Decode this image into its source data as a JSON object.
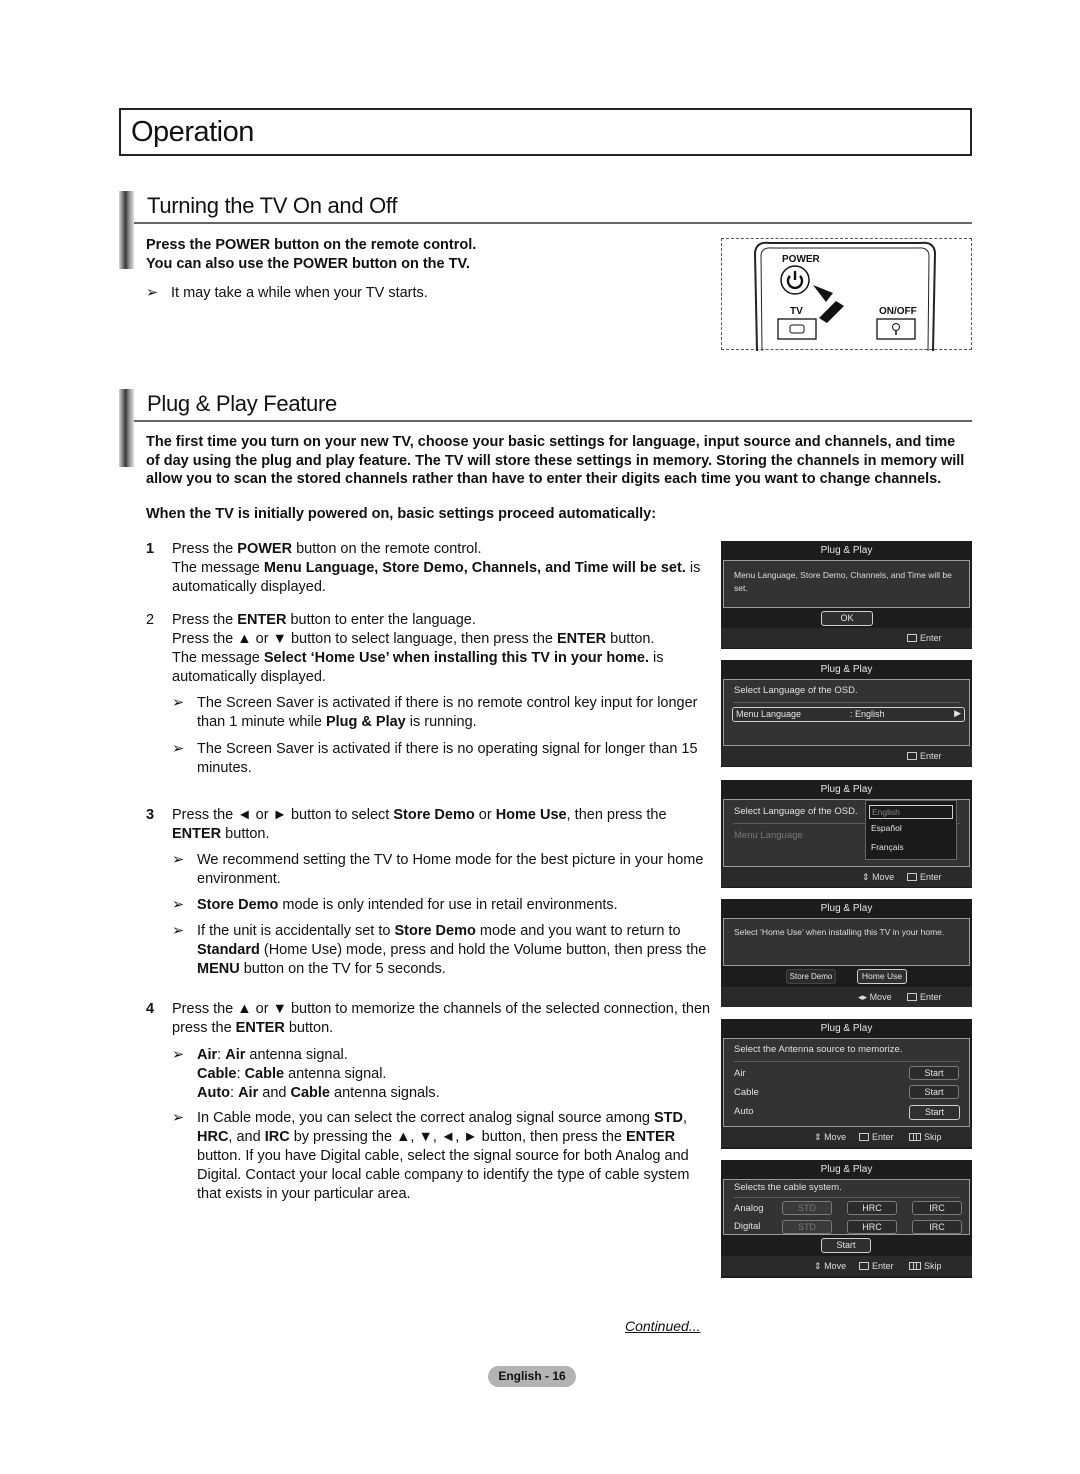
{
  "chapter_title": "Operation",
  "section1": {
    "title": "Turning the TV On and Off",
    "lead_lines": [
      "Press the POWER button on the remote control.",
      "You can also use the POWER button on the TV."
    ],
    "note": "It may take a while when your TV starts.",
    "remote": {
      "power_label": "POWER",
      "tv_label": "TV",
      "onoff_label": "ON/OFF"
    }
  },
  "section2": {
    "title": "Plug & Play Feature",
    "intro": "The first time you turn on your new TV, choose your basic settings for language, input source and channels, and time of day using the plug and play feature. The TV will store these settings in memory. Storing the channels in memory will allow you to scan the stored channels rather than have to enter their digits each time you want to change channels.",
    "intro2": "When the TV is initially powered on, basic settings proceed automatically:",
    "arrow": "➢"
  },
  "steps": [
    {
      "num": "1",
      "segments": [
        [
          "Press the ",
          false
        ],
        [
          "POWER",
          true
        ],
        [
          " button on the remote control.",
          false
        ],
        [
          "\n",
          false
        ],
        [
          "The message ",
          false
        ],
        [
          "Menu Language, Store Demo, Channels, and Time will be set.",
          true
        ],
        [
          " is automatically displayed.",
          false
        ]
      ]
    },
    {
      "num": "2",
      "segments": [
        [
          "Press the ",
          false
        ],
        [
          "ENTER",
          true
        ],
        [
          " button to enter the language.",
          false
        ],
        [
          "\n",
          false
        ],
        [
          "Press the ▲ or ▼ button to select language, then press the ",
          false
        ],
        [
          "ENTER",
          true
        ],
        [
          " button.",
          false
        ],
        [
          "\n",
          false
        ],
        [
          "The message ",
          false
        ],
        [
          "Select ‘Home Use’ when installing this TV in your home.",
          true
        ],
        [
          " is automatically displayed.",
          false
        ]
      ],
      "notes": [
        [
          [
            "The Screen Saver is activated if there is no remote control key input for longer than 1 minute while ",
            false
          ],
          [
            "Plug & Play",
            true
          ],
          [
            " is running.",
            false
          ]
        ],
        [
          [
            "The Screen Saver is activated if there is no operating signal for longer than 15 minutes.",
            false
          ]
        ]
      ]
    },
    {
      "num": "3",
      "segments": [
        [
          "Press the ◄ or ► button to select ",
          false
        ],
        [
          "Store Demo",
          true
        ],
        [
          " or ",
          false
        ],
        [
          "Home Use",
          true
        ],
        [
          ", then press the ",
          false
        ],
        [
          "ENTER",
          true
        ],
        [
          " button.",
          false
        ]
      ],
      "notes": [
        [
          [
            "We recommend setting the TV to Home mode for the best picture in your home environment.",
            false
          ]
        ],
        [
          [
            "Store Demo",
            true
          ],
          [
            " mode is only intended for use in retail environments.",
            false
          ]
        ],
        [
          [
            "If the unit is accidentally set to ",
            false
          ],
          [
            "Store Demo",
            true
          ],
          [
            " mode and you want to return to ",
            false
          ],
          [
            "Standard",
            true
          ],
          [
            " (Home Use) mode, press and hold the Volume button, then press the ",
            false
          ],
          [
            "MENU",
            true
          ],
          [
            " button on the TV for 5 seconds.",
            false
          ]
        ]
      ]
    },
    {
      "num": "4",
      "segments": [
        [
          "Press the ▲ or ▼ button to memorize the channels of the selected connection, then press the ",
          false
        ],
        [
          "ENTER",
          true
        ],
        [
          " button.",
          false
        ]
      ],
      "notes": [
        [
          [
            "Air",
            true
          ],
          [
            ": ",
            false
          ],
          [
            "Air",
            true
          ],
          [
            " antenna signal.",
            false
          ],
          [
            "\n",
            false
          ],
          [
            "Cable",
            true
          ],
          [
            ": ",
            false
          ],
          [
            "Cable",
            true
          ],
          [
            " antenna signal.",
            false
          ],
          [
            "\n",
            false
          ],
          [
            "Auto",
            true
          ],
          [
            ": ",
            false
          ],
          [
            "Air",
            true
          ],
          [
            " and ",
            false
          ],
          [
            "Cable",
            true
          ],
          [
            " antenna signals.",
            false
          ]
        ],
        [
          [
            "In Cable mode, you can select the correct analog signal source among ",
            false
          ],
          [
            "STD",
            true
          ],
          [
            ", ",
            false
          ],
          [
            "HRC",
            true
          ],
          [
            ", and ",
            false
          ],
          [
            "IRC",
            true
          ],
          [
            " by pressing the ▲, ▼, ◄, ► button, then press the ",
            false
          ],
          [
            "ENTER",
            true
          ],
          [
            " button. If you have Digital cable, select the signal source for both Analog and Digital. Contact your local cable company to identify the type of cable system that exists in your particular area.",
            false
          ]
        ]
      ]
    }
  ],
  "osd": {
    "title": "Plug & Play",
    "enter": "Enter",
    "move": "Move",
    "skip": "Skip",
    "screen1": {
      "message": "Menu Language, Store Demo, Channels, and Time will be set.",
      "ok": "OK"
    },
    "screen2": {
      "prompt": "Select Language of the OSD.",
      "row_label": "Menu Language",
      "row_value": ": English"
    },
    "screen3": {
      "prompt": "Select Language of the OSD.",
      "row_label": "Menu Language",
      "options": [
        "English",
        "Español",
        "Français"
      ],
      "selected": "English"
    },
    "screen4": {
      "message": "Select ‘Home Use’ when installing this TV in your home.",
      "store_demo": "Store Demo",
      "home_use": "Home Use",
      "selected": "Home Use"
    },
    "screen5": {
      "prompt": "Select the Antenna source to memorize.",
      "rows": [
        "Air",
        "Cable",
        "Auto"
      ],
      "start": "Start",
      "selected": "Auto"
    },
    "screen6": {
      "prompt": "Selects the cable system.",
      "rows": [
        "Analog",
        "Digital"
      ],
      "options": [
        "STD",
        "HRC",
        "IRC"
      ],
      "start": "Start"
    }
  },
  "footer": {
    "continued": "Continued...",
    "page": "English - 16"
  }
}
